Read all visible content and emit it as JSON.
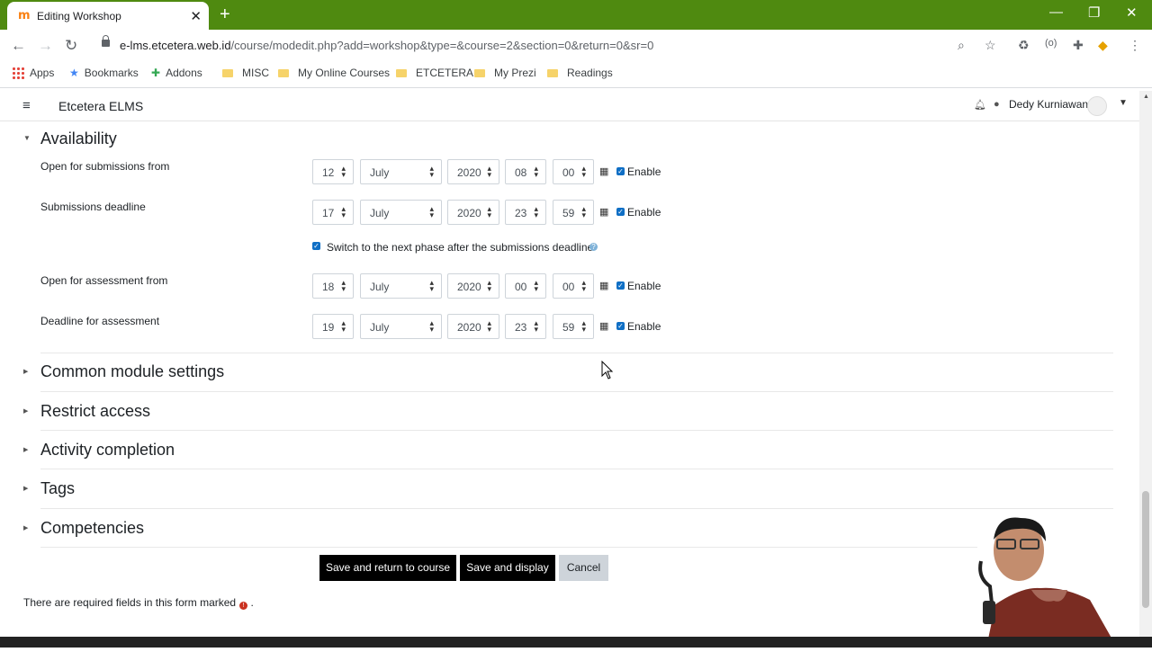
{
  "browser": {
    "tab_title": "Editing Workshop",
    "url_host": "e-lms.etcetera.web.id",
    "url_path": "/course/modedit.php?add=workshop&type=&course=2&section=0&return=0&sr=0",
    "bookmarks": [
      "Apps",
      "Bookmarks",
      "Addons",
      "MISC",
      "My Online Courses",
      "ETCETERA",
      "My Prezi",
      "Readings"
    ]
  },
  "navbar": {
    "site_name": "Etcetera ELMS",
    "user_name": "Dedy Kurniawan"
  },
  "availability": {
    "heading": "Availability",
    "rows": [
      {
        "label": "Open for submissions from",
        "day": "12",
        "month": "July",
        "year": "2020",
        "hour": "08",
        "minute": "00",
        "enable": "Enable"
      },
      {
        "label": "Submissions deadline",
        "day": "17",
        "month": "July",
        "year": "2020",
        "hour": "23",
        "minute": "59",
        "enable": "Enable"
      },
      {
        "label": "Open for assessment from",
        "day": "18",
        "month": "July",
        "year": "2020",
        "hour": "00",
        "minute": "00",
        "enable": "Enable"
      },
      {
        "label": "Deadline for assessment",
        "day": "19",
        "month": "July",
        "year": "2020",
        "hour": "23",
        "minute": "59",
        "enable": "Enable"
      }
    ],
    "switch_label": "Switch to the next phase after the submissions deadline"
  },
  "sections": [
    "Common module settings",
    "Restrict access",
    "Activity completion",
    "Tags",
    "Competencies"
  ],
  "buttons": {
    "save_return": "Save and return to course",
    "save_display": "Save and display",
    "cancel": "Cancel"
  },
  "required_note": "There are required fields in this form marked",
  "required_note_end": ".",
  "theme": {
    "tab_bar": "#4f8a10",
    "primary_button": "#000000",
    "checkbox": "#0f6fc5"
  }
}
